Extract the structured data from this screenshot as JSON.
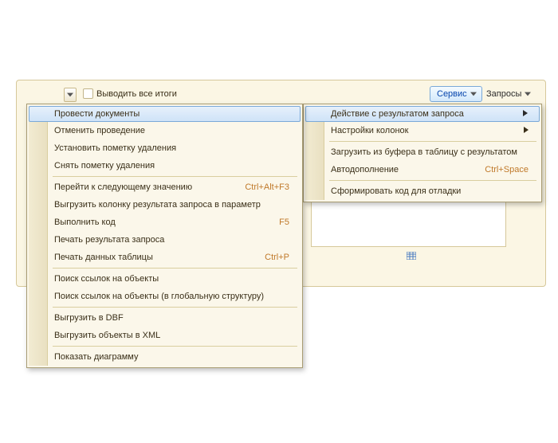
{
  "toolbar": {
    "checkbox_label": "Выводить все итоги",
    "service_label": "Сервис",
    "queries_label": "Запросы"
  },
  "menu_main": {
    "items": [
      {
        "label": "Провести документы",
        "highlighted": true
      },
      {
        "label": "Отменить проведение"
      },
      {
        "label": "Установить пометку удаления"
      },
      {
        "label": "Снять пометку удаления"
      },
      {
        "sep": true
      },
      {
        "label": "Перейти к следующему значению",
        "shortcut": "Ctrl+Alt+F3"
      },
      {
        "label": "Выгрузить колонку результата запроса в параметр"
      },
      {
        "label": "Выполнить код",
        "shortcut": "F5"
      },
      {
        "label": "Печать результата запроса"
      },
      {
        "label": "Печать данных таблицы",
        "shortcut": "Ctrl+P"
      },
      {
        "sep": true
      },
      {
        "label": "Поиск ссылок на объекты"
      },
      {
        "label": "Поиск ссылок на объекты (в глобальную структуру)"
      },
      {
        "sep": true
      },
      {
        "label": "Выгрузить в DBF"
      },
      {
        "label": "Выгрузить объекты в XML"
      },
      {
        "sep": true
      },
      {
        "label": "Показать диаграмму"
      }
    ]
  },
  "menu_sub": {
    "items": [
      {
        "label": "Действие с результатом запроса",
        "highlighted": true,
        "submenu": true
      },
      {
        "label": "Настройки колонок",
        "submenu": true
      },
      {
        "sep": true
      },
      {
        "label": "Загрузить из буфера в таблицу с результатом"
      },
      {
        "label": "Автодополнение",
        "shortcut": "Ctrl+Space"
      },
      {
        "sep": true
      },
      {
        "label": "Сформировать код для отладки"
      }
    ]
  }
}
